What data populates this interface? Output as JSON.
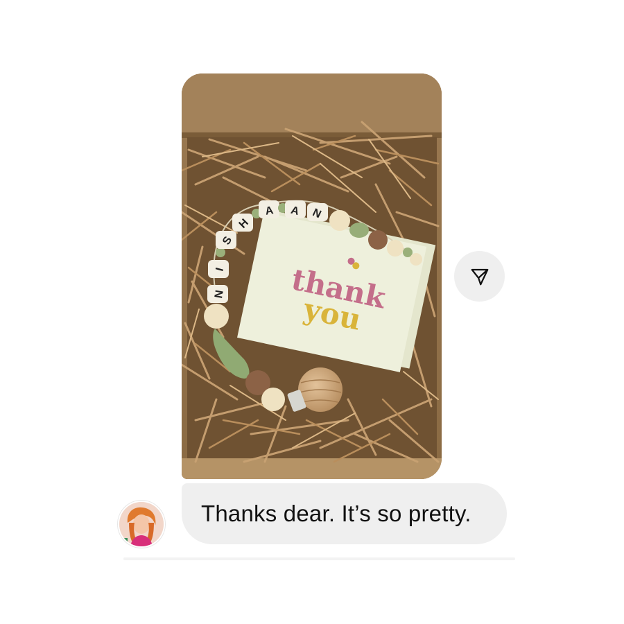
{
  "conversation": {
    "message": {
      "text": "Thanks dear. It’s so pretty."
    },
    "photo": {
      "bracelet_letters": [
        "N",
        "I",
        "S",
        "H",
        "A",
        "A",
        "N"
      ],
      "card_line1": "thank",
      "card_line2": "you"
    }
  },
  "icons": {
    "share": "paper-plane-icon",
    "avatar": "profile-avatar"
  },
  "colors": {
    "bubble": "#efefef",
    "share_button_bg": "#efefef",
    "text": "#111111",
    "card_pink": "#c46e8a",
    "card_yellow": "#d9b43a",
    "card_bg": "#eef0dc"
  }
}
